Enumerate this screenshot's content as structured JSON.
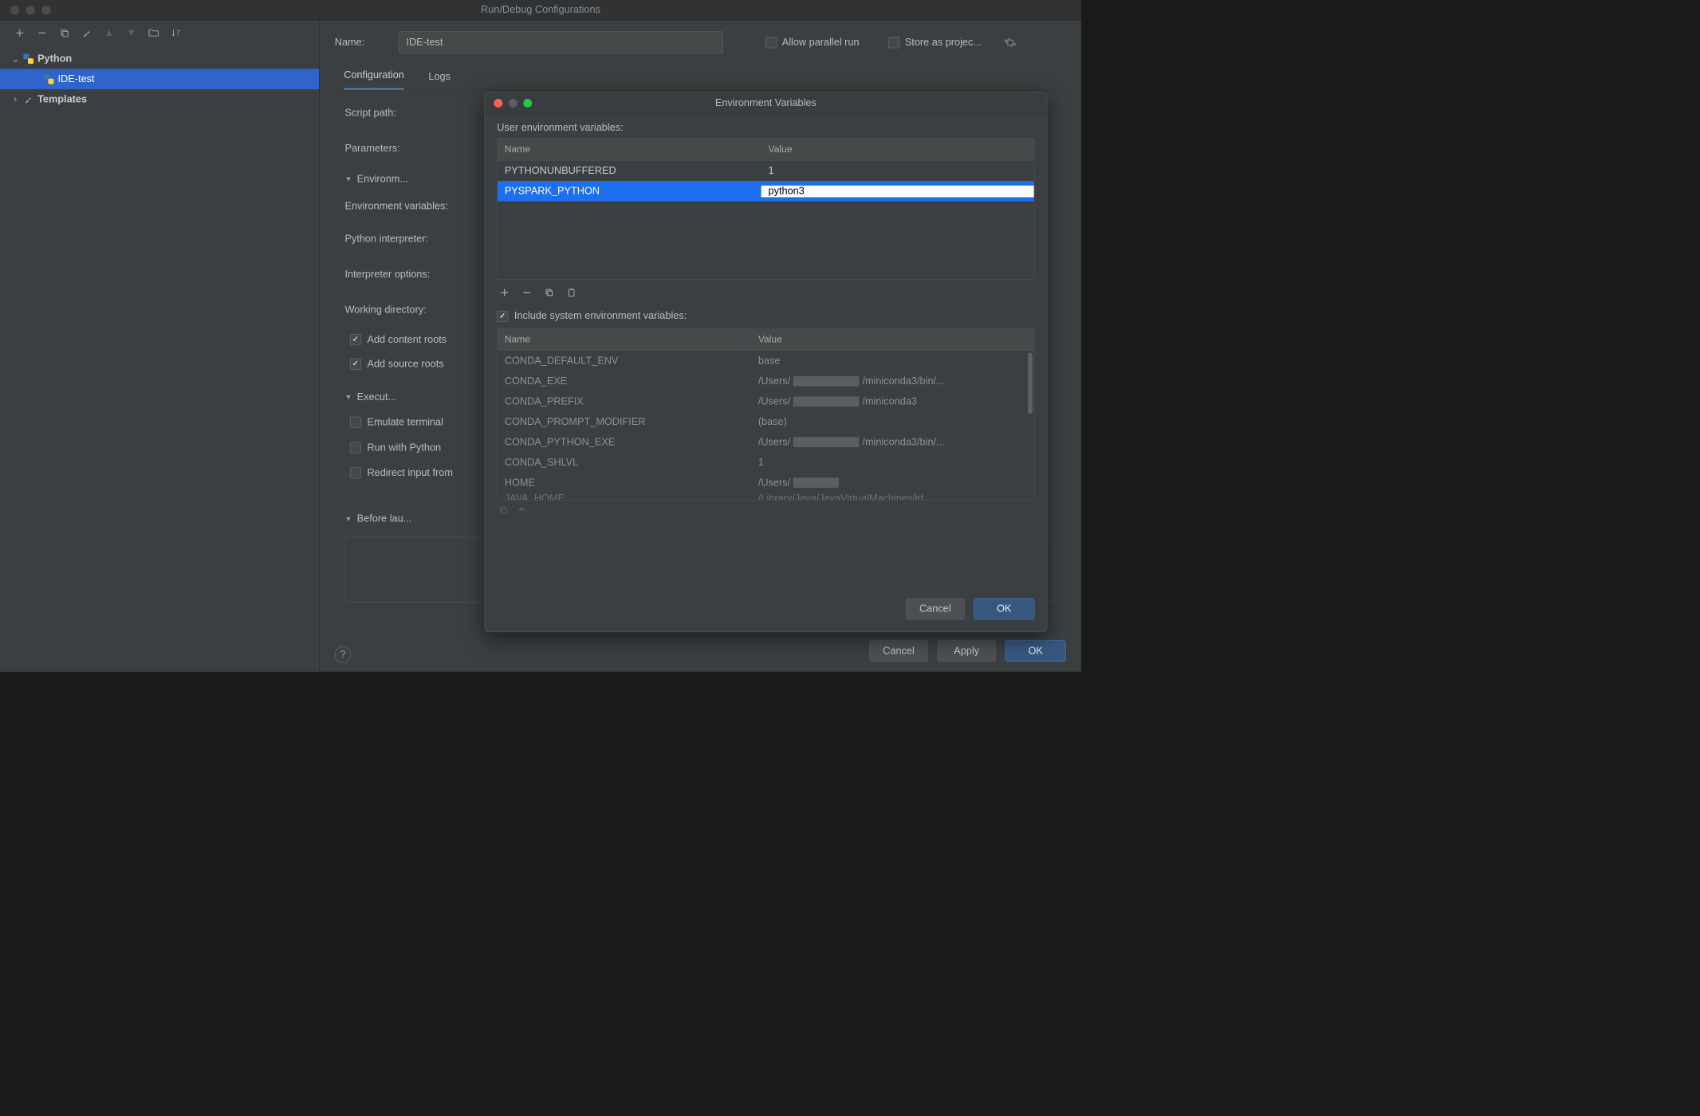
{
  "window": {
    "title": "Run/Debug Configurations"
  },
  "left": {
    "root": "Python",
    "selected": "IDE-test",
    "templates": "Templates"
  },
  "form": {
    "name_label": "Name:",
    "name_value": "IDE-test",
    "allow_parallel": "Allow parallel run",
    "store_project": "Store as projec...",
    "tabs": {
      "config": "Configuration",
      "logs": "Logs"
    },
    "labels": {
      "script_path": "Script path:",
      "parameters": "Parameters:",
      "env_section": "Environm...",
      "env_vars": "Environment variables:",
      "py_interp": "Python interpreter:",
      "interp_opts": "Interpreter options:",
      "workdir": "Working directory:",
      "add_content_roots": "Add content roots",
      "add_source_roots": "Add source roots",
      "exec_section": "Execut...",
      "emulate_terminal": "Emulate terminal",
      "run_with_python": "Run with Python",
      "redirect_input": "Redirect input from",
      "before_launch": "Before lau..."
    }
  },
  "env_dialog": {
    "title": "Environment Variables",
    "user_label": "User environment variables:",
    "thead_name": "Name",
    "thead_value": "Value",
    "user_vars": [
      {
        "name": "PYTHONUNBUFFERED",
        "value": "1"
      },
      {
        "name": "PYSPARK_PYTHON",
        "value": "python3"
      }
    ],
    "include_label": "Include system environment variables:",
    "sys_vars": [
      {
        "name": "CONDA_DEFAULT_ENV",
        "value": "base"
      },
      {
        "name": "CONDA_EXE",
        "value_prefix": "/Users/",
        "value_suffix": "/miniconda3/bin/..."
      },
      {
        "name": "CONDA_PREFIX",
        "value_prefix": "/Users/",
        "value_suffix": "/miniconda3"
      },
      {
        "name": "CONDA_PROMPT_MODIFIER",
        "value": "(base)"
      },
      {
        "name": "CONDA_PYTHON_EXE",
        "value_prefix": "/Users/",
        "value_suffix": "/miniconda3/bin/..."
      },
      {
        "name": "CONDA_SHLVL",
        "value": "1"
      },
      {
        "name": "HOME",
        "value_prefix": "/Users/",
        "value_suffix": ""
      },
      {
        "name": "JAVA_HOME",
        "value": "/Library/Java/JavaVirtualMachines/jd"
      }
    ],
    "buttons": {
      "cancel": "Cancel",
      "ok": "OK"
    }
  },
  "footer": {
    "cancel": "Cancel",
    "apply": "Apply",
    "ok": "OK"
  }
}
